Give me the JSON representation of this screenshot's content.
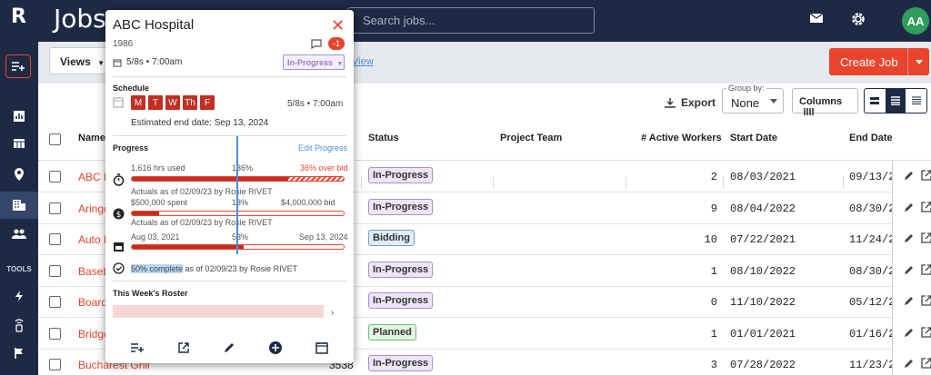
{
  "app": {
    "title": "Jobs",
    "logo": "R"
  },
  "header": {
    "search_placeholder": "Search jobs...",
    "avatar_initials": "AA"
  },
  "rail": {
    "tools_label": "TOOLS"
  },
  "toolbar": {
    "views_label": "Views",
    "view_link": "View",
    "create_label": "Create Job"
  },
  "panel": {
    "export_label": "Export",
    "group_by_label": "Group by:",
    "group_by_value": "None",
    "columns_label": "Columns"
  },
  "table": {
    "headers": {
      "name": "Name",
      "status": "Status",
      "team": "Project Team",
      "workers": "# Active Workers",
      "start": "Start Date",
      "end": "End Date"
    },
    "rows": [
      {
        "name": "ABC H",
        "status": "In-Progress",
        "workers": "2",
        "start": "08/03/2021",
        "end": "09/13/2"
      },
      {
        "name": "Aringe",
        "status": "In-Progress",
        "workers": "9",
        "start": "08/04/2022",
        "end": "08/30/2"
      },
      {
        "name": "Auto P",
        "status": "Bidding",
        "workers": "10",
        "start": "07/22/2021",
        "end": "11/24/2"
      },
      {
        "name": "Baseba",
        "status": "In-Progress",
        "workers": "1",
        "start": "08/10/2022",
        "end": "08/30/2"
      },
      {
        "name": "Board",
        "status": "In-Progress",
        "workers": "0",
        "start": "11/10/2022",
        "end": "05/12/2"
      },
      {
        "name": "Bridge",
        "status": "Planned",
        "workers": "1",
        "start": "01/01/2021",
        "end": "01/16/2"
      },
      {
        "name": "Bucharest Grill",
        "id": "3538",
        "status": "In-Progress",
        "workers": "3",
        "start": "07/28/2022",
        "end": "11/23/2"
      }
    ]
  },
  "popup": {
    "title": "ABC Hospital",
    "year": "1986",
    "comment_count": "-1",
    "schedule_short": "5/8s • 7:00am",
    "status": "In-Progress",
    "schedule_heading": "Schedule",
    "days": [
      "M",
      "T",
      "W",
      "Th",
      "F"
    ],
    "schedule_right": "5/8s • 7:00am",
    "estimated_end": "Estimated end date: Sep 13, 2024",
    "progress_heading": "Progress",
    "edit_progress": "Edit Progress",
    "hours": {
      "left": "1,616 hrs used",
      "pct": "136%",
      "right": "36% over bid",
      "actuals": "Actuals as of 02/09/23 by Rosie RIVET",
      "fill": 0.74
    },
    "budget": {
      "left": "$500,000 spent",
      "pct": "13%",
      "right": "$4,000,000 bid",
      "actuals": "Actuals as of 02/09/23 by Rosie RIVET",
      "fill": 0.13
    },
    "time": {
      "left": "Aug 03, 2021",
      "pct": "53%",
      "right": "Sep 13, 2024",
      "fill": 0.53
    },
    "complete_highlight": "50% complete",
    "complete_rest": " as of 02/09/23 by Rosie RIVET",
    "roster_heading": "This Week's Roster"
  }
}
